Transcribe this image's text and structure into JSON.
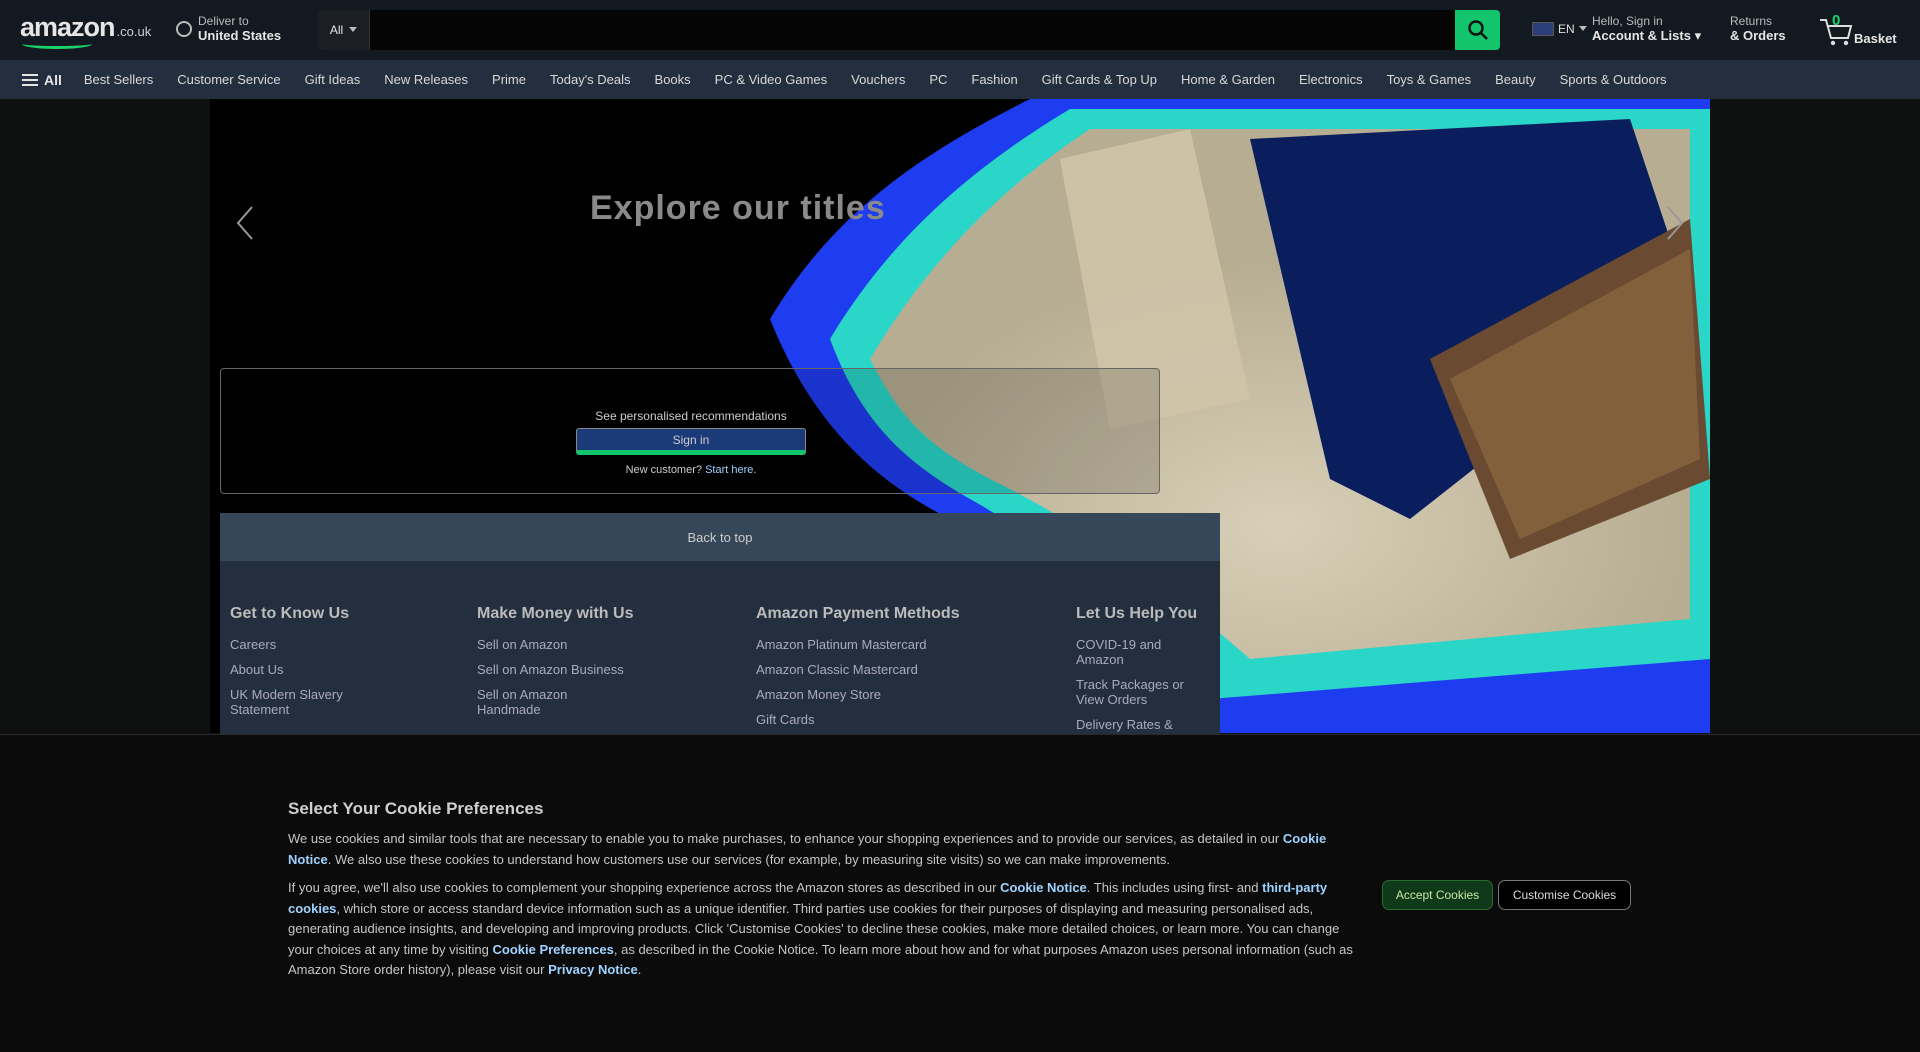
{
  "header": {
    "logo_word": "amazon",
    "logo_tld": ".co.uk",
    "deliver_line1": "Deliver to",
    "deliver_line2": "United States",
    "search_category": "All",
    "search_placeholder": "",
    "language": "EN",
    "account_line1": "Hello, Sign in",
    "account_line2": "Account & Lists",
    "returns_line1": "Returns",
    "returns_line2": "& Orders",
    "cart_count": "0",
    "cart_label": "Basket"
  },
  "nav": {
    "all_label": "All",
    "items": [
      "Best Sellers",
      "Customer Service",
      "Gift Ideas",
      "New Releases",
      "Prime",
      "Today's Deals",
      "Books",
      "PC & Video Games",
      "Vouchers",
      "PC",
      "Fashion",
      "Gift Cards & Top Up",
      "Home & Garden",
      "Electronics",
      "Toys & Games",
      "Beauty",
      "Sports & Outdoors"
    ]
  },
  "hero": {
    "title": "Explore our titles"
  },
  "signin_card": {
    "text": "See personalised recommendations",
    "button": "Sign in",
    "new_customer": "New customer?",
    "start_here": "Start here."
  },
  "footer": {
    "back_to_top": "Back to top",
    "columns": [
      {
        "title": "Get to Know Us",
        "links": [
          "Careers",
          "About Us",
          "UK Modern Slavery Statement"
        ]
      },
      {
        "title": "Make Money with Us",
        "links": [
          "Sell on Amazon",
          "Sell on Amazon Business",
          "Sell on Amazon Handmade"
        ]
      },
      {
        "title": "Amazon Payment Methods",
        "links": [
          "Amazon Platinum Mastercard",
          "Amazon Classic Mastercard",
          "Amazon Money Store",
          "Gift Cards"
        ]
      },
      {
        "title": "Let Us Help You",
        "links": [
          "COVID-19 and Amazon",
          "Track Packages or View Orders",
          "Delivery Rates &"
        ]
      }
    ]
  },
  "cookie": {
    "title": "Select Your Cookie Preferences",
    "p1_a": "We use cookies and similar tools that are necessary to enable you to make purchases, to enhance your shopping experiences and to provide our services, as detailed in our ",
    "p1_link": "Cookie Notice",
    "p1_b": ". We also use these cookies to understand how customers use our services (for example, by measuring site visits) so we can make improvements.",
    "p2_a": "If you agree, we'll also use cookies to complement your shopping experience across the Amazon stores as described in our ",
    "p2_link1": "Cookie Notice",
    "p2_b": ". This includes using first- and ",
    "p2_link2": "third-party cookies",
    "p2_c": ", which store or access standard device information such as a unique identifier. Third parties use cookies for their purposes of displaying and measuring personalised ads, generating audience insights, and developing and improving products. Click 'Customise Cookies' to decline these cookies, make more detailed choices, or learn more. You can change your choices at any time by visiting ",
    "p2_link3": "Cookie Preferences",
    "p2_d": ", as described in the Cookie Notice. To learn more about how and for what purposes Amazon uses personal information (such as Amazon Store order history), please visit our ",
    "p2_link4": "Privacy Notice",
    "p2_e": ".",
    "accept": "Accept Cookies",
    "customise": "Customise Cookies"
  },
  "colors": {
    "accent_green": "#12c46b",
    "nav_bg": "#232f3e",
    "header_bg": "#131921"
  }
}
